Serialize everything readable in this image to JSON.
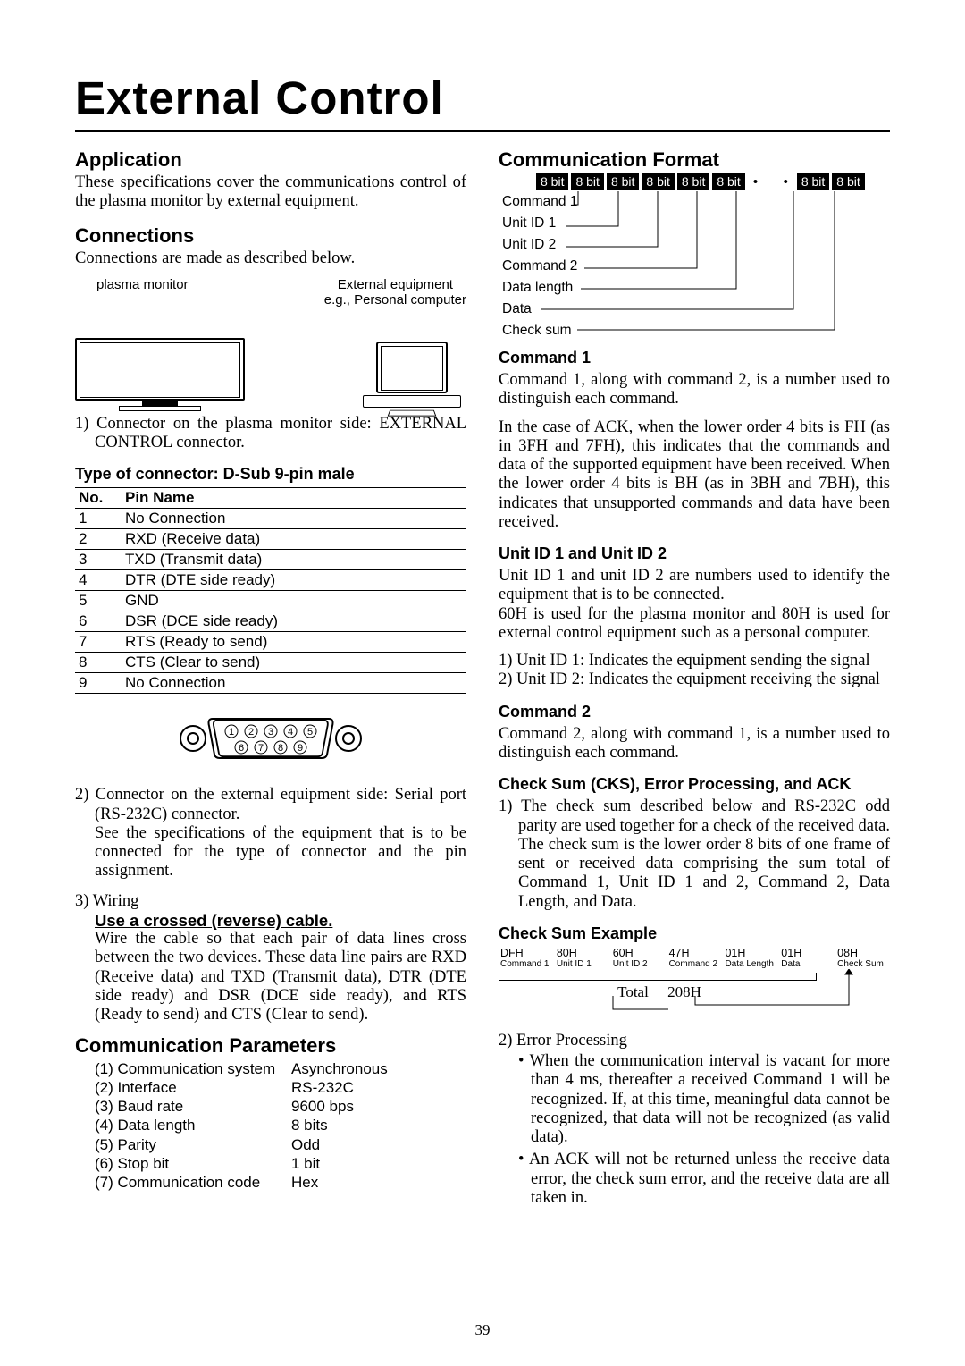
{
  "title": "External Control",
  "page_number": "39",
  "left": {
    "application": {
      "heading": "Application",
      "text": "These specifications cover the communications control of the plasma monitor by external equipment."
    },
    "connections": {
      "heading": "Connections",
      "intro": "Connections are made as described below.",
      "label_plasma": "plasma monitor",
      "label_ext1": "External equipment",
      "label_ext2": "e.g., Personal computer",
      "item1": "1) Connector on the plasma monitor side: EXTERNAL CONTROL connector.",
      "connector_heading": "Type of connector: D-Sub 9-pin male",
      "table_head_no": "No.",
      "table_head_pin": "Pin Name",
      "pins": [
        {
          "no": "1",
          "name": "No Connection"
        },
        {
          "no": "2",
          "name": "RXD (Receive data)"
        },
        {
          "no": "3",
          "name": "TXD (Transmit data)"
        },
        {
          "no": "4",
          "name": "DTR (DTE side ready)"
        },
        {
          "no": "5",
          "name": "GND"
        },
        {
          "no": "6",
          "name": "DSR (DCE side ready)"
        },
        {
          "no": "7",
          "name": "RTS (Ready to send)"
        },
        {
          "no": "8",
          "name": "CTS (Clear to send)"
        },
        {
          "no": "9",
          "name": "No Connection"
        }
      ],
      "item2a": "2) Connector on the external equipment side: Serial port (RS-232C) connector.",
      "item2b": "See the specifications of the equipment that is to be connected for the type of connector and the pin assignment.",
      "item3_head": "3) Wiring",
      "item3_u": "Use a crossed (reverse) cable.",
      "item3_body": "Wire the cable so that each pair of data lines cross between the two devices. These data line pairs are RXD (Receive data) and TXD (Transmit data), DTR (DTE side ready) and DSR (DCE side ready), and RTS (Ready to send) and CTS (Clear to send)."
    },
    "comm_params": {
      "heading": "Communication Parameters",
      "rows": [
        {
          "k": "(1) Communication system",
          "v": "Asynchronous"
        },
        {
          "k": "(2) Interface",
          "v": "RS-232C"
        },
        {
          "k": "(3) Baud rate",
          "v": "9600 bps"
        },
        {
          "k": "(4) Data length",
          "v": "8 bits"
        },
        {
          "k": "(5) Parity",
          "v": "Odd"
        },
        {
          "k": "(6) Stop bit",
          "v": "1 bit"
        },
        {
          "k": "(7) Communication code",
          "v": "Hex"
        }
      ]
    }
  },
  "right": {
    "cf": {
      "heading": "Communication Format",
      "bit": "8 bit",
      "labels": [
        "Command 1",
        "Unit ID 1",
        "Unit ID 2",
        "Command 2",
        "Data length",
        "Data",
        "Check sum"
      ]
    },
    "cmd1": {
      "heading": "Command 1",
      "p1": "Command 1, along with command 2, is a number used to distinguish each command.",
      "p2": "In the case of ACK, when the lower order 4 bits is FH (as in 3FH and 7FH), this indicates that the commands and data of the supported equipment have been received. When the lower order 4 bits is BH (as in 3BH and 7BH), this indicates that unsupported commands and data have been received."
    },
    "uid": {
      "heading": "Unit ID 1 and Unit ID 2",
      "p1": "Unit ID 1 and unit ID 2 are numbers used to identify the equipment that is to be connected.",
      "p2": "60H is used for the plasma monitor and 80H is used for external control equipment such as a personal computer.",
      "l1": "1) Unit ID 1: Indicates the equipment sending the signal",
      "l2": "2) Unit ID 2: Indicates the equipment receiving the signal"
    },
    "cmd2": {
      "heading": "Command 2",
      "p1": "Command 2, along with command 1, is a number used to distinguish each command."
    },
    "cks": {
      "heading": "Check Sum (CKS), Error Processing, and ACK",
      "p1": "1) The check sum described below and RS-232C odd parity are used together for a check of the received data. The check sum is the lower order 8 bits of one frame of sent or received data comprising the sum total of Command 1, Unit ID 1 and 2, Command 2, Data Length, and Data."
    },
    "cse": {
      "heading": "Check Sum Example",
      "cols": [
        {
          "v": "DFH",
          "s": "Command 1"
        },
        {
          "v": "80H",
          "s": "Unit ID 1"
        },
        {
          "v": "60H",
          "s": "Unit ID 2"
        },
        {
          "v": "47H",
          "s": "Command 2"
        },
        {
          "v": "01H",
          "s": "Data Length"
        },
        {
          "v": "01H",
          "s": "Data"
        },
        {
          "v": "08H",
          "s": "Check Sum"
        }
      ],
      "total_label": "Total",
      "total_value": "208H"
    },
    "err": {
      "lead": "2) Error Processing",
      "b1": "When the communication interval is vacant for more than 4 ms, thereafter a received Command 1 will be recognized. If, at this time, meaningful data cannot be recognized, that data will not be recognized (as valid data).",
      "b2": "An ACK will not be returned unless the receive data error, the check sum error, and the receive data are all taken in."
    }
  }
}
